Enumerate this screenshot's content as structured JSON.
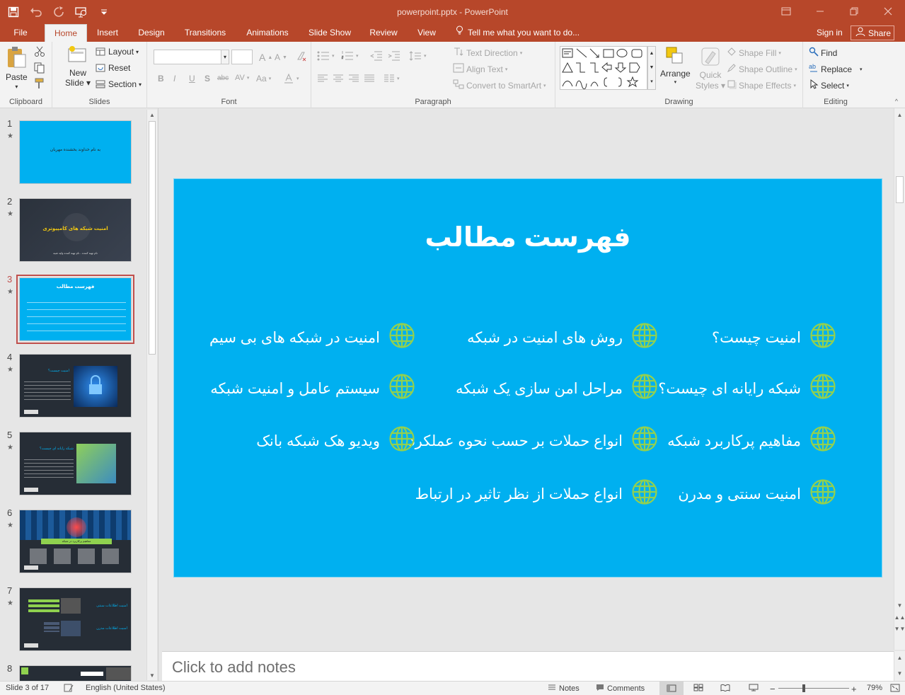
{
  "app": {
    "window_title": "powerpoint.pptx - PowerPoint",
    "accent_color": "#b7472a"
  },
  "quick_access": {
    "icons": [
      "save-icon",
      "undo-icon",
      "redo-icon",
      "present-from-start-icon",
      "customize-qat-icon"
    ]
  },
  "tabs": [
    {
      "label": "File"
    },
    {
      "label": "Home",
      "active": true
    },
    {
      "label": "Insert"
    },
    {
      "label": "Design"
    },
    {
      "label": "Transitions"
    },
    {
      "label": "Animations"
    },
    {
      "label": "Slide Show"
    },
    {
      "label": "Review"
    },
    {
      "label": "View"
    }
  ],
  "tell_me": "Tell me what you want to do...",
  "sign_in": "Sign in",
  "share": "Share",
  "ribbon": {
    "clipboard": {
      "label": "Clipboard",
      "paste": "Paste"
    },
    "slides": {
      "label": "Slides",
      "new_slide_1": "New",
      "new_slide_2": "Slide",
      "layout": "Layout",
      "reset": "Reset",
      "section": "Section"
    },
    "font": {
      "label": "Font",
      "font_name": "",
      "font_size": "",
      "bold": "B",
      "italic": "I",
      "underline": "U",
      "shadow": "S",
      "strike": "abc",
      "spacing": "AV",
      "case": "Aa",
      "grow": "A",
      "shrink": "A"
    },
    "paragraph": {
      "label": "Paragraph",
      "text_direction": "Text Direction",
      "align_text": "Align Text",
      "smartart": "Convert to SmartArt"
    },
    "drawing": {
      "label": "Drawing",
      "arrange": "Arrange",
      "quick_styles_1": "Quick",
      "quick_styles_2": "Styles",
      "shape_fill": "Shape Fill",
      "shape_outline": "Shape Outline",
      "shape_effects": "Shape Effects"
    },
    "editing": {
      "label": "Editing",
      "find": "Find",
      "replace": "Replace",
      "select": "Select"
    }
  },
  "thumbnails": [
    {
      "num": "1",
      "title": "به نام خداوند بخشنده مهربان",
      "subtitle": ""
    },
    {
      "num": "2",
      "title": "امنیت  شبکه های کامپیوتری",
      "subtitle": "نام تهیه کننده - نام تهیه کننده ولید شیه"
    },
    {
      "num": "3",
      "title": "فهرست مطالب",
      "subtitle": ""
    },
    {
      "num": "4",
      "title": "امنیت چیست؟",
      "subtitle": ""
    },
    {
      "num": "5",
      "title": "شبکه رایانه ای چیست؟",
      "subtitle": ""
    },
    {
      "num": "6",
      "title": "مفاهیم پرکاربرد در شبکه",
      "subtitle": ""
    },
    {
      "num": "7",
      "title": "امنیت اطلاعات سنتی",
      "subtitle": "امنیت اطلاعات مدرن"
    },
    {
      "num": "8",
      "title": "",
      "subtitle": ""
    }
  ],
  "slide": {
    "title": "فهرست مطالب",
    "background": "#00b0f0",
    "columns": [
      [
        "امنیت چیست؟",
        "شبکه رایانه ای چیست؟",
        "مفاهیم پرکاربرد شبکه",
        "امنیت سنتی و مدرن"
      ],
      [
        "روش های امنیت در شبکه",
        "مراحل امن سازی یک شبکه",
        "انواع حملات بر حسب نحوه عملکرد",
        "انواع حملات از نظر تاثیر در ارتباط"
      ],
      [
        "امنیت در شبکه های بی سیم",
        "سیستم عامل و امنیت شبکه",
        "ویدیو هک شبکه بانک"
      ]
    ]
  },
  "notes_placeholder": "Click to add notes",
  "status": {
    "slide_info": "Slide 3 of 17",
    "language": "English (United States)",
    "notes": "Notes",
    "comments": "Comments",
    "zoom": "79%"
  }
}
